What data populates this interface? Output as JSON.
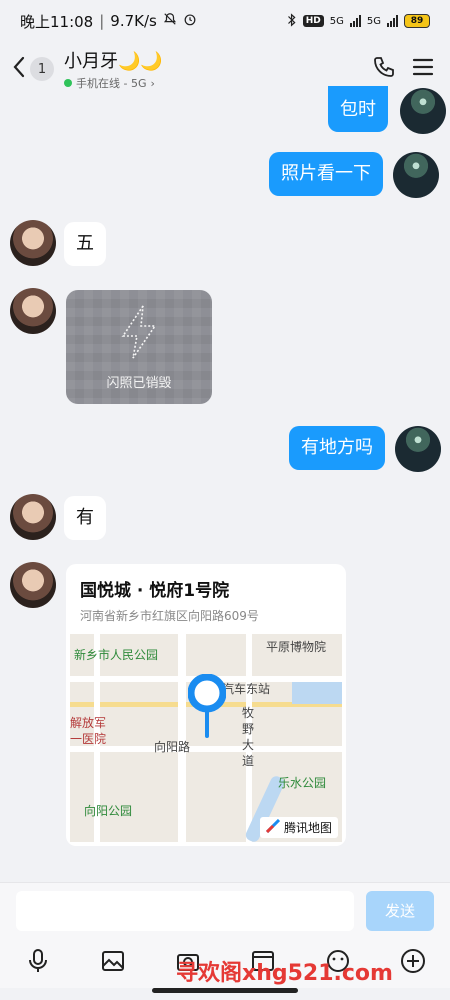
{
  "status_bar": {
    "time": "晚上11:08",
    "speed": "9.7K/s",
    "network_1": "5G",
    "network_2": "5G",
    "battery": "89"
  },
  "header": {
    "back_count": "1",
    "title": "小月牙🌙🌙",
    "status_text": "手机在线 - 5G",
    "phone_icon": "phone-icon",
    "menu_icon": "menu-icon"
  },
  "messages": [
    {
      "from": "me",
      "type": "text",
      "text": "包时"
    },
    {
      "from": "me",
      "type": "text",
      "text": "照片看一下"
    },
    {
      "from": "her",
      "type": "text",
      "text": "五"
    },
    {
      "from": "her",
      "type": "flash_photo",
      "text": "闪照已销毁"
    },
    {
      "from": "me",
      "type": "text",
      "text": "有地方吗"
    },
    {
      "from": "her",
      "type": "text",
      "text": "有"
    },
    {
      "from": "her",
      "type": "location",
      "title": "国悦城 · 悦府1号院",
      "address": "河南省新乡市红旗区向阳路609号",
      "map_labels": {
        "park1": "新乡市人民公园",
        "museum": "平原博物院",
        "station": "汽车东站",
        "hospital_1": "解放军",
        "hospital_2": "一医院",
        "road_1": "向阳路",
        "road_2": "牧",
        "road_3": "野",
        "road_4": "大",
        "road_5": "道",
        "park2": "乐水公园",
        "park3": "向阳公园",
        "brand": "腾讯地图"
      }
    }
  ],
  "input": {
    "send_label": "发送",
    "placeholder": ""
  },
  "toolbar": {
    "icons": [
      "mic-icon",
      "photo-icon",
      "camera-icon",
      "image-icon",
      "emoji-icon",
      "plus-icon"
    ]
  },
  "watermark": "寻欢阁xhg521.com"
}
